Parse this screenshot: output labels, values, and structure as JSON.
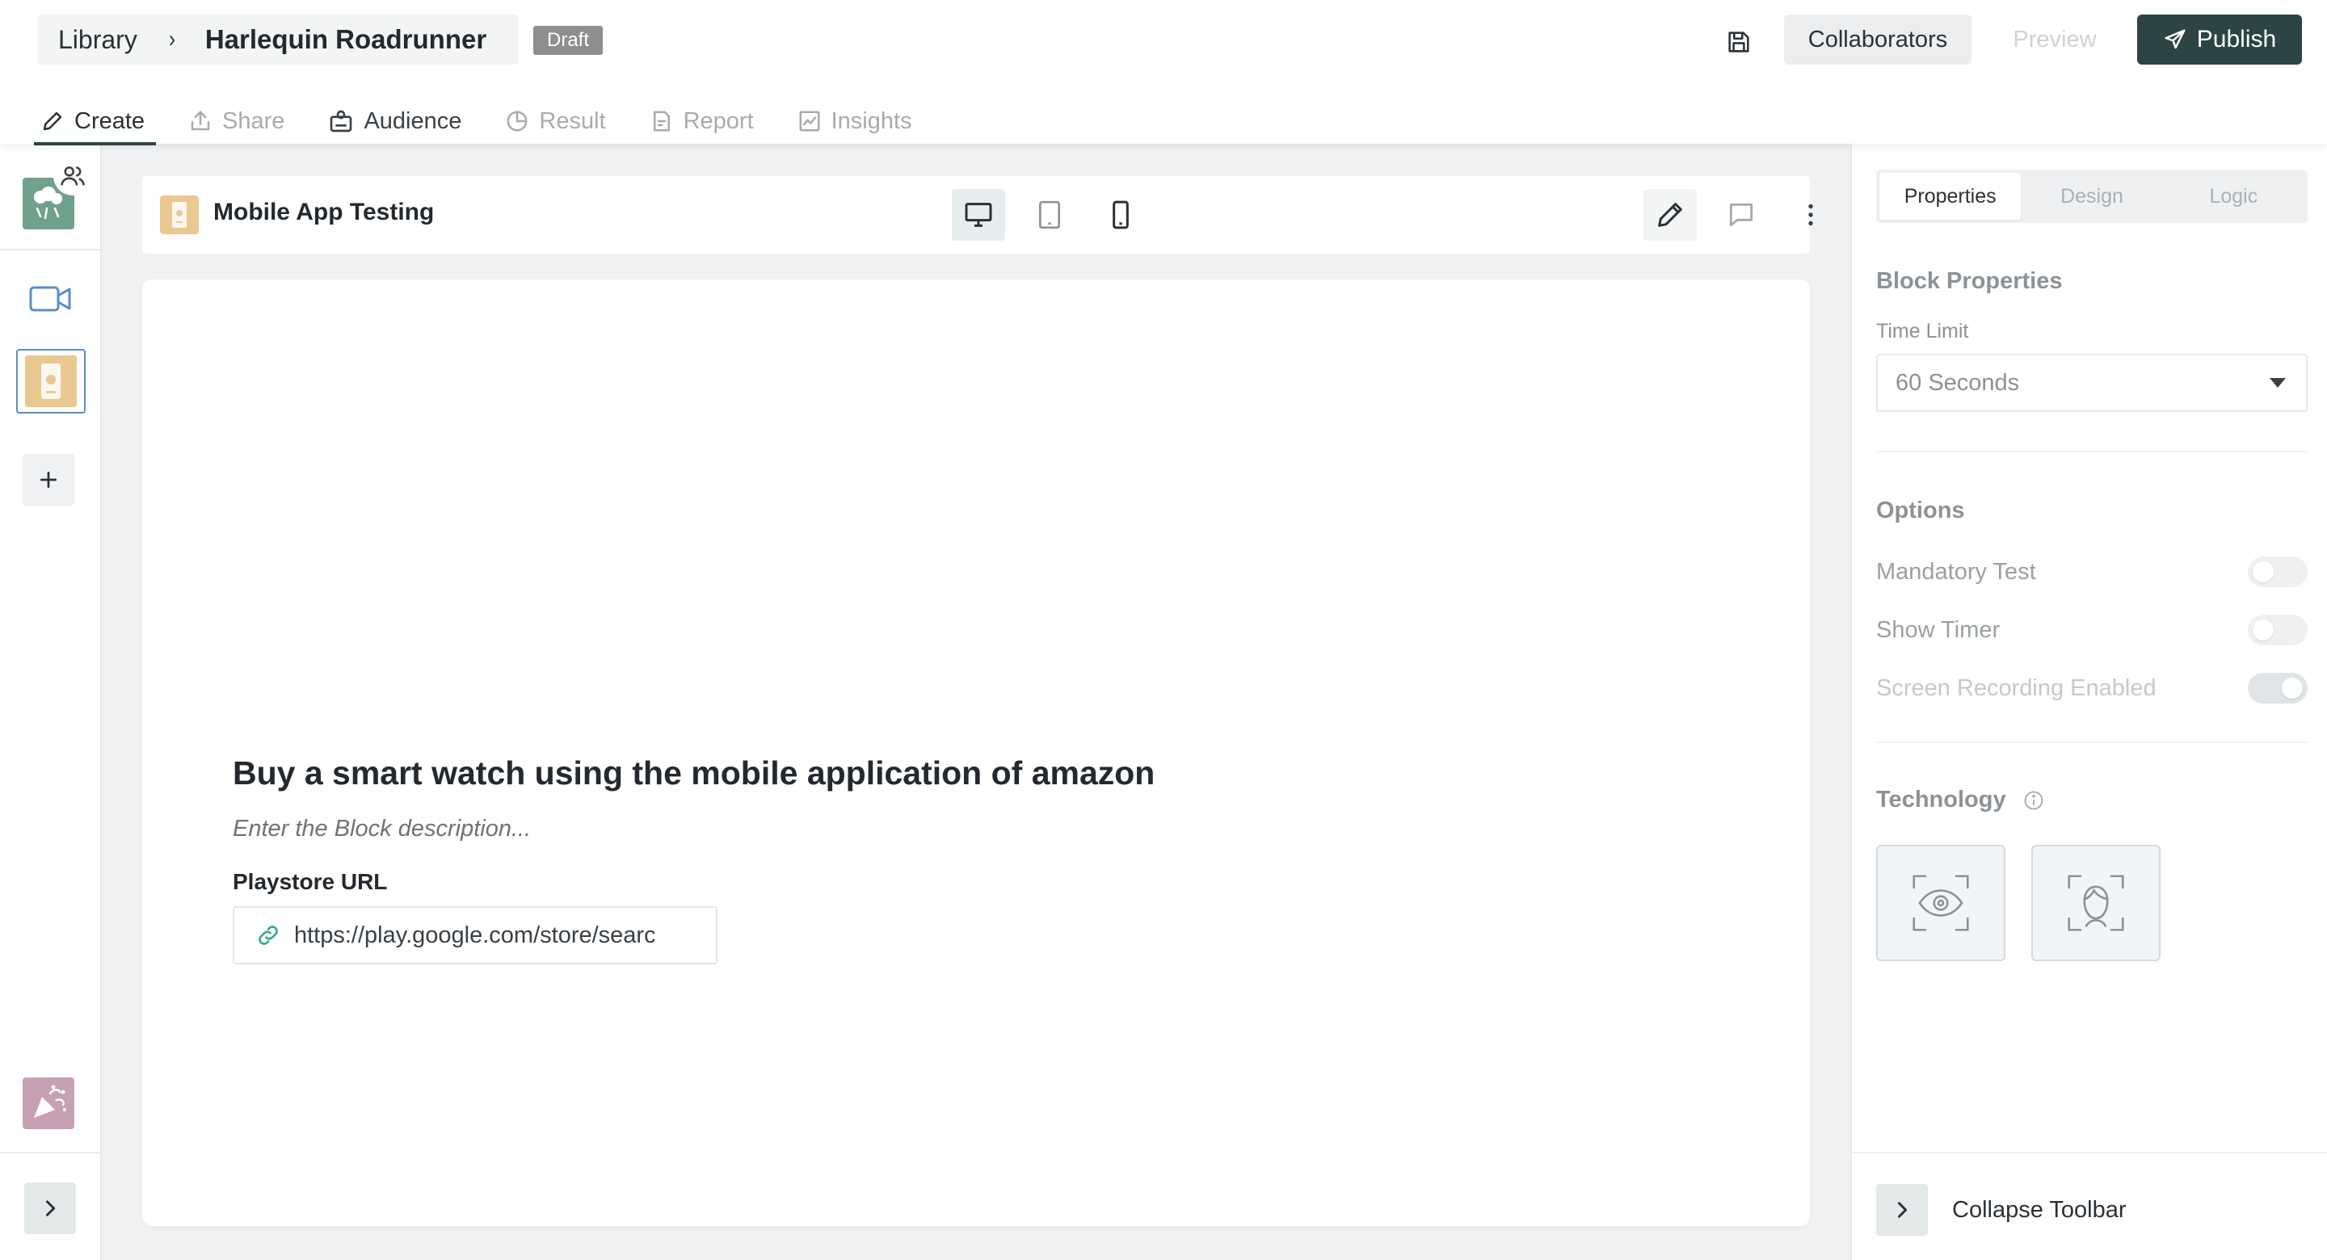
{
  "breadcrumb": {
    "library": "Library",
    "separator": "›",
    "project": "Harlequin Roadrunner"
  },
  "status_badge": "Draft",
  "header_actions": {
    "save_icon": "save-icon",
    "collaborators": "Collaborators",
    "preview": "Preview",
    "publish": "Publish"
  },
  "tabs": [
    {
      "label": "Create",
      "icon": "pencil-icon",
      "state": "active"
    },
    {
      "label": "Share",
      "icon": "share-icon",
      "state": "disabled"
    },
    {
      "label": "Audience",
      "icon": "audience-icon",
      "state": "enabled"
    },
    {
      "label": "Result",
      "icon": "pie-chart-icon",
      "state": "disabled"
    },
    {
      "label": "Report",
      "icon": "report-icon",
      "state": "disabled"
    },
    {
      "label": "Insights",
      "icon": "insights-icon",
      "state": "disabled"
    }
  ],
  "left_rail": {
    "items": [
      {
        "name": "welcome-block",
        "icon": "welcome-icon"
      },
      {
        "name": "video-block",
        "icon": "video-icon"
      },
      {
        "name": "mobile-app-block",
        "icon": "mobile-app-icon",
        "selected": true
      },
      {
        "name": "add-block",
        "icon": "plus-icon"
      },
      {
        "name": "thank-you-block",
        "icon": "party-icon"
      }
    ],
    "expand_icon": "chevron-right-icon"
  },
  "block_toolbar": {
    "title": "Mobile App Testing",
    "devices": [
      "desktop",
      "tablet",
      "mobile"
    ],
    "active_device": "desktop",
    "actions": [
      "edit",
      "comment",
      "more"
    ]
  },
  "block": {
    "title": "Buy a smart watch using the mobile application of amazon",
    "description_placeholder": "Enter the Block description...",
    "url_label": "Playstore URL",
    "url_value": "https://play.google.com/store/search?q=amazon&c=apps"
  },
  "panel": {
    "tabs": [
      "Properties",
      "Design",
      "Logic"
    ],
    "active_tab": "Properties",
    "block_properties_heading": "Block Properties",
    "time_limit_label": "Time Limit",
    "time_limit_value": "60 Seconds",
    "options_heading": "Options",
    "options": [
      {
        "label": "Mandatory Test",
        "on": false,
        "disabled": false
      },
      {
        "label": "Show Timer",
        "on": false,
        "disabled": false
      },
      {
        "label": "Screen Recording Enabled",
        "on": true,
        "disabled": true
      }
    ],
    "technology_heading": "Technology",
    "technology_options": [
      "eye-tracking",
      "face-tracking"
    ],
    "collapse_label": "Collapse Toolbar"
  },
  "colors": {
    "primary_dark": "#2d4444",
    "welcome_block": "#6fa18d",
    "mobile_block": "#e9c991",
    "thankyou_block": "#c7a0b3",
    "video_accent": "#5b8dc9"
  }
}
